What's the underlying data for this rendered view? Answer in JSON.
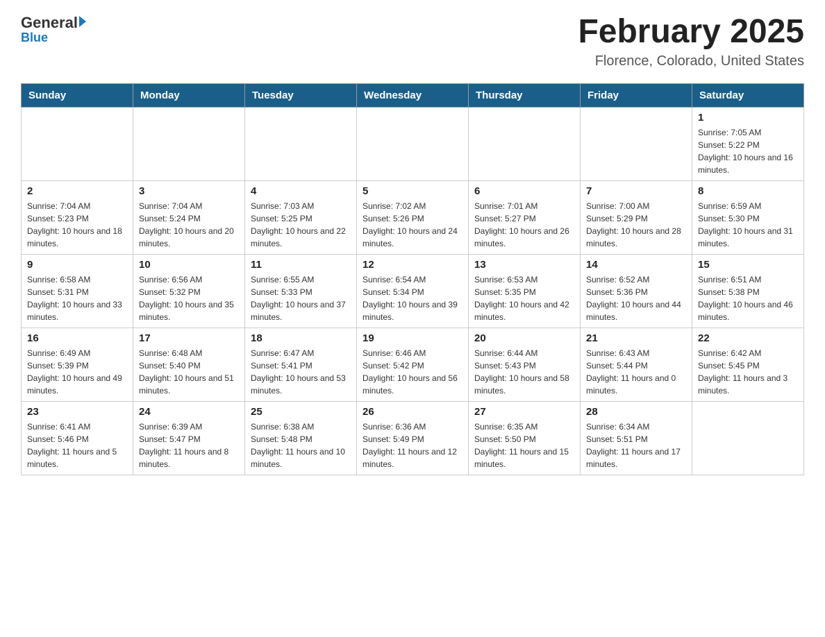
{
  "header": {
    "logo": {
      "general": "General",
      "blue": "Blue"
    },
    "title": "February 2025",
    "location": "Florence, Colorado, United States"
  },
  "weekdays": [
    "Sunday",
    "Monday",
    "Tuesday",
    "Wednesday",
    "Thursday",
    "Friday",
    "Saturday"
  ],
  "weeks": [
    [
      {
        "day": "",
        "sunrise": "",
        "sunset": "",
        "daylight": ""
      },
      {
        "day": "",
        "sunrise": "",
        "sunset": "",
        "daylight": ""
      },
      {
        "day": "",
        "sunrise": "",
        "sunset": "",
        "daylight": ""
      },
      {
        "day": "",
        "sunrise": "",
        "sunset": "",
        "daylight": ""
      },
      {
        "day": "",
        "sunrise": "",
        "sunset": "",
        "daylight": ""
      },
      {
        "day": "",
        "sunrise": "",
        "sunset": "",
        "daylight": ""
      },
      {
        "day": "1",
        "sunrise": "Sunrise: 7:05 AM",
        "sunset": "Sunset: 5:22 PM",
        "daylight": "Daylight: 10 hours and 16 minutes."
      }
    ],
    [
      {
        "day": "2",
        "sunrise": "Sunrise: 7:04 AM",
        "sunset": "Sunset: 5:23 PM",
        "daylight": "Daylight: 10 hours and 18 minutes."
      },
      {
        "day": "3",
        "sunrise": "Sunrise: 7:04 AM",
        "sunset": "Sunset: 5:24 PM",
        "daylight": "Daylight: 10 hours and 20 minutes."
      },
      {
        "day": "4",
        "sunrise": "Sunrise: 7:03 AM",
        "sunset": "Sunset: 5:25 PM",
        "daylight": "Daylight: 10 hours and 22 minutes."
      },
      {
        "day": "5",
        "sunrise": "Sunrise: 7:02 AM",
        "sunset": "Sunset: 5:26 PM",
        "daylight": "Daylight: 10 hours and 24 minutes."
      },
      {
        "day": "6",
        "sunrise": "Sunrise: 7:01 AM",
        "sunset": "Sunset: 5:27 PM",
        "daylight": "Daylight: 10 hours and 26 minutes."
      },
      {
        "day": "7",
        "sunrise": "Sunrise: 7:00 AM",
        "sunset": "Sunset: 5:29 PM",
        "daylight": "Daylight: 10 hours and 28 minutes."
      },
      {
        "day": "8",
        "sunrise": "Sunrise: 6:59 AM",
        "sunset": "Sunset: 5:30 PM",
        "daylight": "Daylight: 10 hours and 31 minutes."
      }
    ],
    [
      {
        "day": "9",
        "sunrise": "Sunrise: 6:58 AM",
        "sunset": "Sunset: 5:31 PM",
        "daylight": "Daylight: 10 hours and 33 minutes."
      },
      {
        "day": "10",
        "sunrise": "Sunrise: 6:56 AM",
        "sunset": "Sunset: 5:32 PM",
        "daylight": "Daylight: 10 hours and 35 minutes."
      },
      {
        "day": "11",
        "sunrise": "Sunrise: 6:55 AM",
        "sunset": "Sunset: 5:33 PM",
        "daylight": "Daylight: 10 hours and 37 minutes."
      },
      {
        "day": "12",
        "sunrise": "Sunrise: 6:54 AM",
        "sunset": "Sunset: 5:34 PM",
        "daylight": "Daylight: 10 hours and 39 minutes."
      },
      {
        "day": "13",
        "sunrise": "Sunrise: 6:53 AM",
        "sunset": "Sunset: 5:35 PM",
        "daylight": "Daylight: 10 hours and 42 minutes."
      },
      {
        "day": "14",
        "sunrise": "Sunrise: 6:52 AM",
        "sunset": "Sunset: 5:36 PM",
        "daylight": "Daylight: 10 hours and 44 minutes."
      },
      {
        "day": "15",
        "sunrise": "Sunrise: 6:51 AM",
        "sunset": "Sunset: 5:38 PM",
        "daylight": "Daylight: 10 hours and 46 minutes."
      }
    ],
    [
      {
        "day": "16",
        "sunrise": "Sunrise: 6:49 AM",
        "sunset": "Sunset: 5:39 PM",
        "daylight": "Daylight: 10 hours and 49 minutes."
      },
      {
        "day": "17",
        "sunrise": "Sunrise: 6:48 AM",
        "sunset": "Sunset: 5:40 PM",
        "daylight": "Daylight: 10 hours and 51 minutes."
      },
      {
        "day": "18",
        "sunrise": "Sunrise: 6:47 AM",
        "sunset": "Sunset: 5:41 PM",
        "daylight": "Daylight: 10 hours and 53 minutes."
      },
      {
        "day": "19",
        "sunrise": "Sunrise: 6:46 AM",
        "sunset": "Sunset: 5:42 PM",
        "daylight": "Daylight: 10 hours and 56 minutes."
      },
      {
        "day": "20",
        "sunrise": "Sunrise: 6:44 AM",
        "sunset": "Sunset: 5:43 PM",
        "daylight": "Daylight: 10 hours and 58 minutes."
      },
      {
        "day": "21",
        "sunrise": "Sunrise: 6:43 AM",
        "sunset": "Sunset: 5:44 PM",
        "daylight": "Daylight: 11 hours and 0 minutes."
      },
      {
        "day": "22",
        "sunrise": "Sunrise: 6:42 AM",
        "sunset": "Sunset: 5:45 PM",
        "daylight": "Daylight: 11 hours and 3 minutes."
      }
    ],
    [
      {
        "day": "23",
        "sunrise": "Sunrise: 6:41 AM",
        "sunset": "Sunset: 5:46 PM",
        "daylight": "Daylight: 11 hours and 5 minutes."
      },
      {
        "day": "24",
        "sunrise": "Sunrise: 6:39 AM",
        "sunset": "Sunset: 5:47 PM",
        "daylight": "Daylight: 11 hours and 8 minutes."
      },
      {
        "day": "25",
        "sunrise": "Sunrise: 6:38 AM",
        "sunset": "Sunset: 5:48 PM",
        "daylight": "Daylight: 11 hours and 10 minutes."
      },
      {
        "day": "26",
        "sunrise": "Sunrise: 6:36 AM",
        "sunset": "Sunset: 5:49 PM",
        "daylight": "Daylight: 11 hours and 12 minutes."
      },
      {
        "day": "27",
        "sunrise": "Sunrise: 6:35 AM",
        "sunset": "Sunset: 5:50 PM",
        "daylight": "Daylight: 11 hours and 15 minutes."
      },
      {
        "day": "28",
        "sunrise": "Sunrise: 6:34 AM",
        "sunset": "Sunset: 5:51 PM",
        "daylight": "Daylight: 11 hours and 17 minutes."
      },
      {
        "day": "",
        "sunrise": "",
        "sunset": "",
        "daylight": ""
      }
    ]
  ]
}
